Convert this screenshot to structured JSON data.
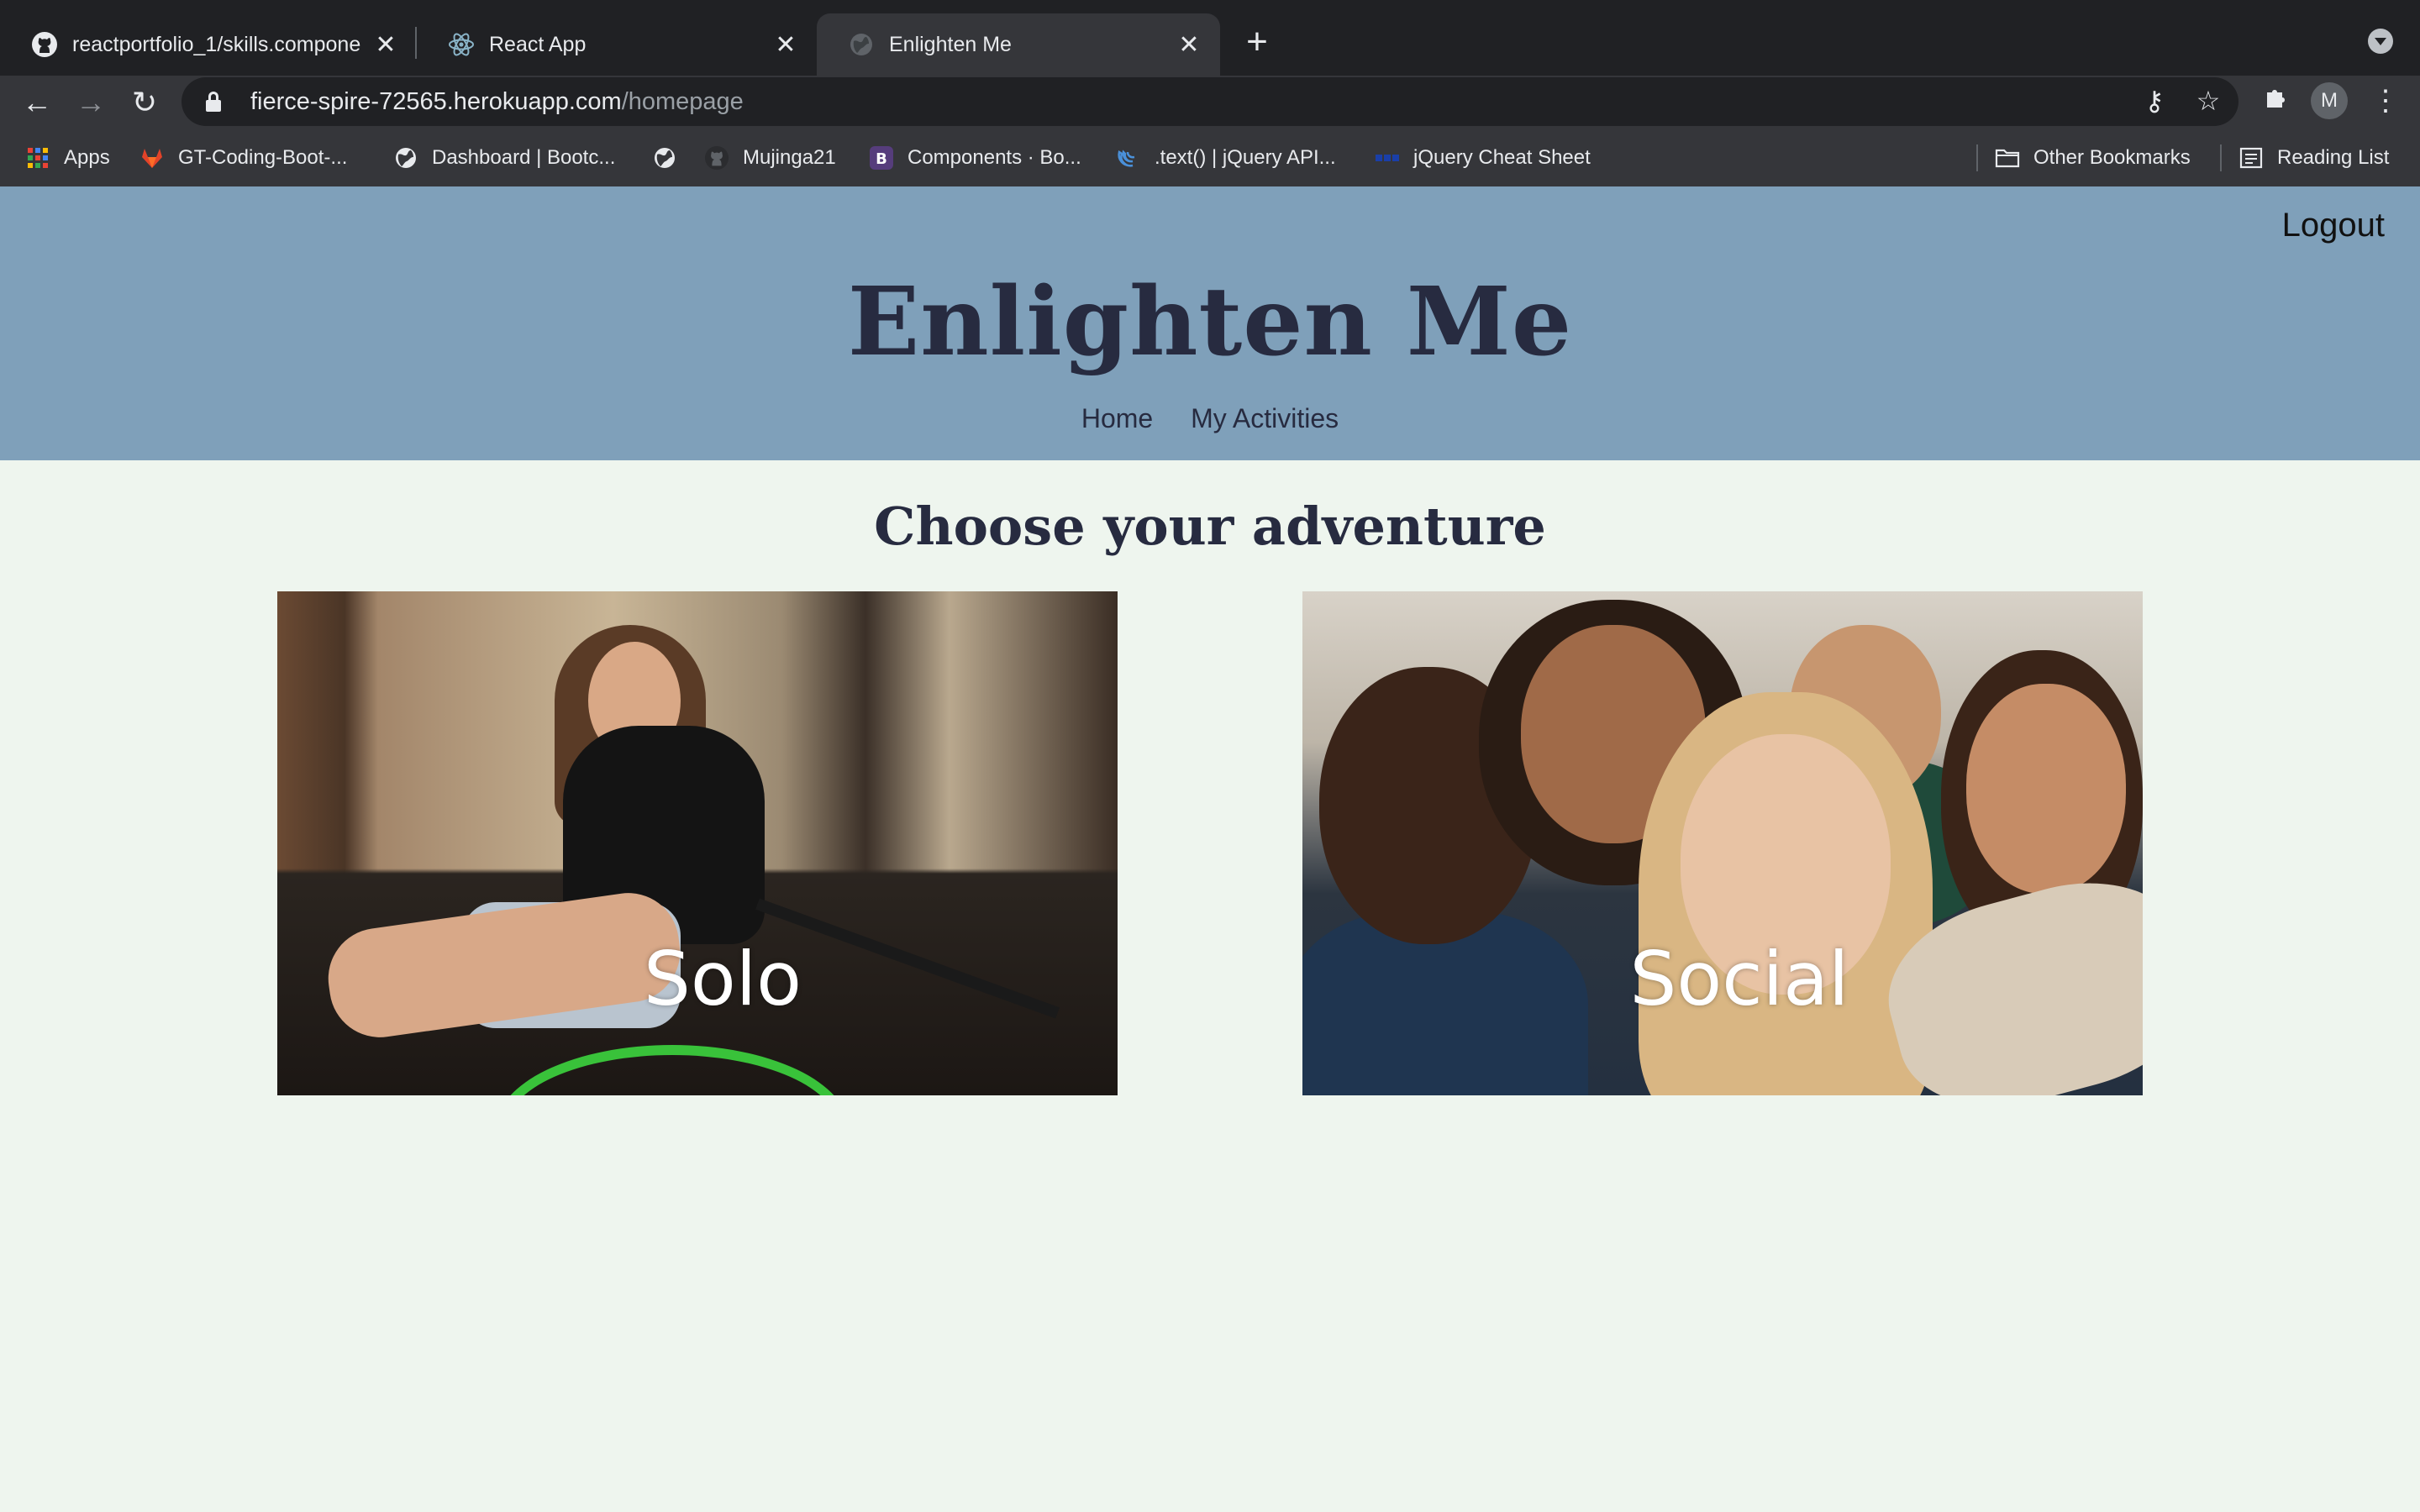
{
  "browser": {
    "tabs": [
      {
        "title": "reactportfolio_1/skills.compone",
        "icon": "github-icon",
        "active": false
      },
      {
        "title": "React App",
        "icon": "react-icon",
        "active": false
      },
      {
        "title": "Enlighten Me",
        "icon": "globe-icon",
        "active": true
      }
    ],
    "address": {
      "host": "fierce-spire-72565.herokuapp.com",
      "path": "/homepage"
    },
    "profile_initial": "M",
    "bookmarks": [
      {
        "label": "Apps",
        "icon": "apps-grid-icon"
      },
      {
        "label": "GT-Coding-Boot-...",
        "icon": "gitlab-icon"
      },
      {
        "label": "Dashboard | Bootc...",
        "icon": "globe-icon"
      },
      {
        "label": "",
        "icon": "globe-icon"
      },
      {
        "label": "Mujinga21",
        "icon": "github-icon"
      },
      {
        "label": "Components · Bo...",
        "icon": "bootstrap-icon"
      },
      {
        "label": ".text() | jQuery API...",
        "icon": "jquery-icon"
      },
      {
        "label": "jQuery Cheat Sheet",
        "icon": "dots-icon"
      }
    ],
    "other_bookmarks": "Other Bookmarks",
    "reading_list": "Reading List"
  },
  "site": {
    "logout": "Logout",
    "title": "Enlighten Me",
    "nav": [
      "Home",
      "My Activities"
    ],
    "section_title": "Choose your adventure",
    "cards": [
      {
        "label": "Solo"
      },
      {
        "label": "Social"
      }
    ],
    "colors": {
      "header_bg": "#7fa0ba",
      "page_bg": "#eef5ee",
      "title_text": "#272b40"
    }
  }
}
